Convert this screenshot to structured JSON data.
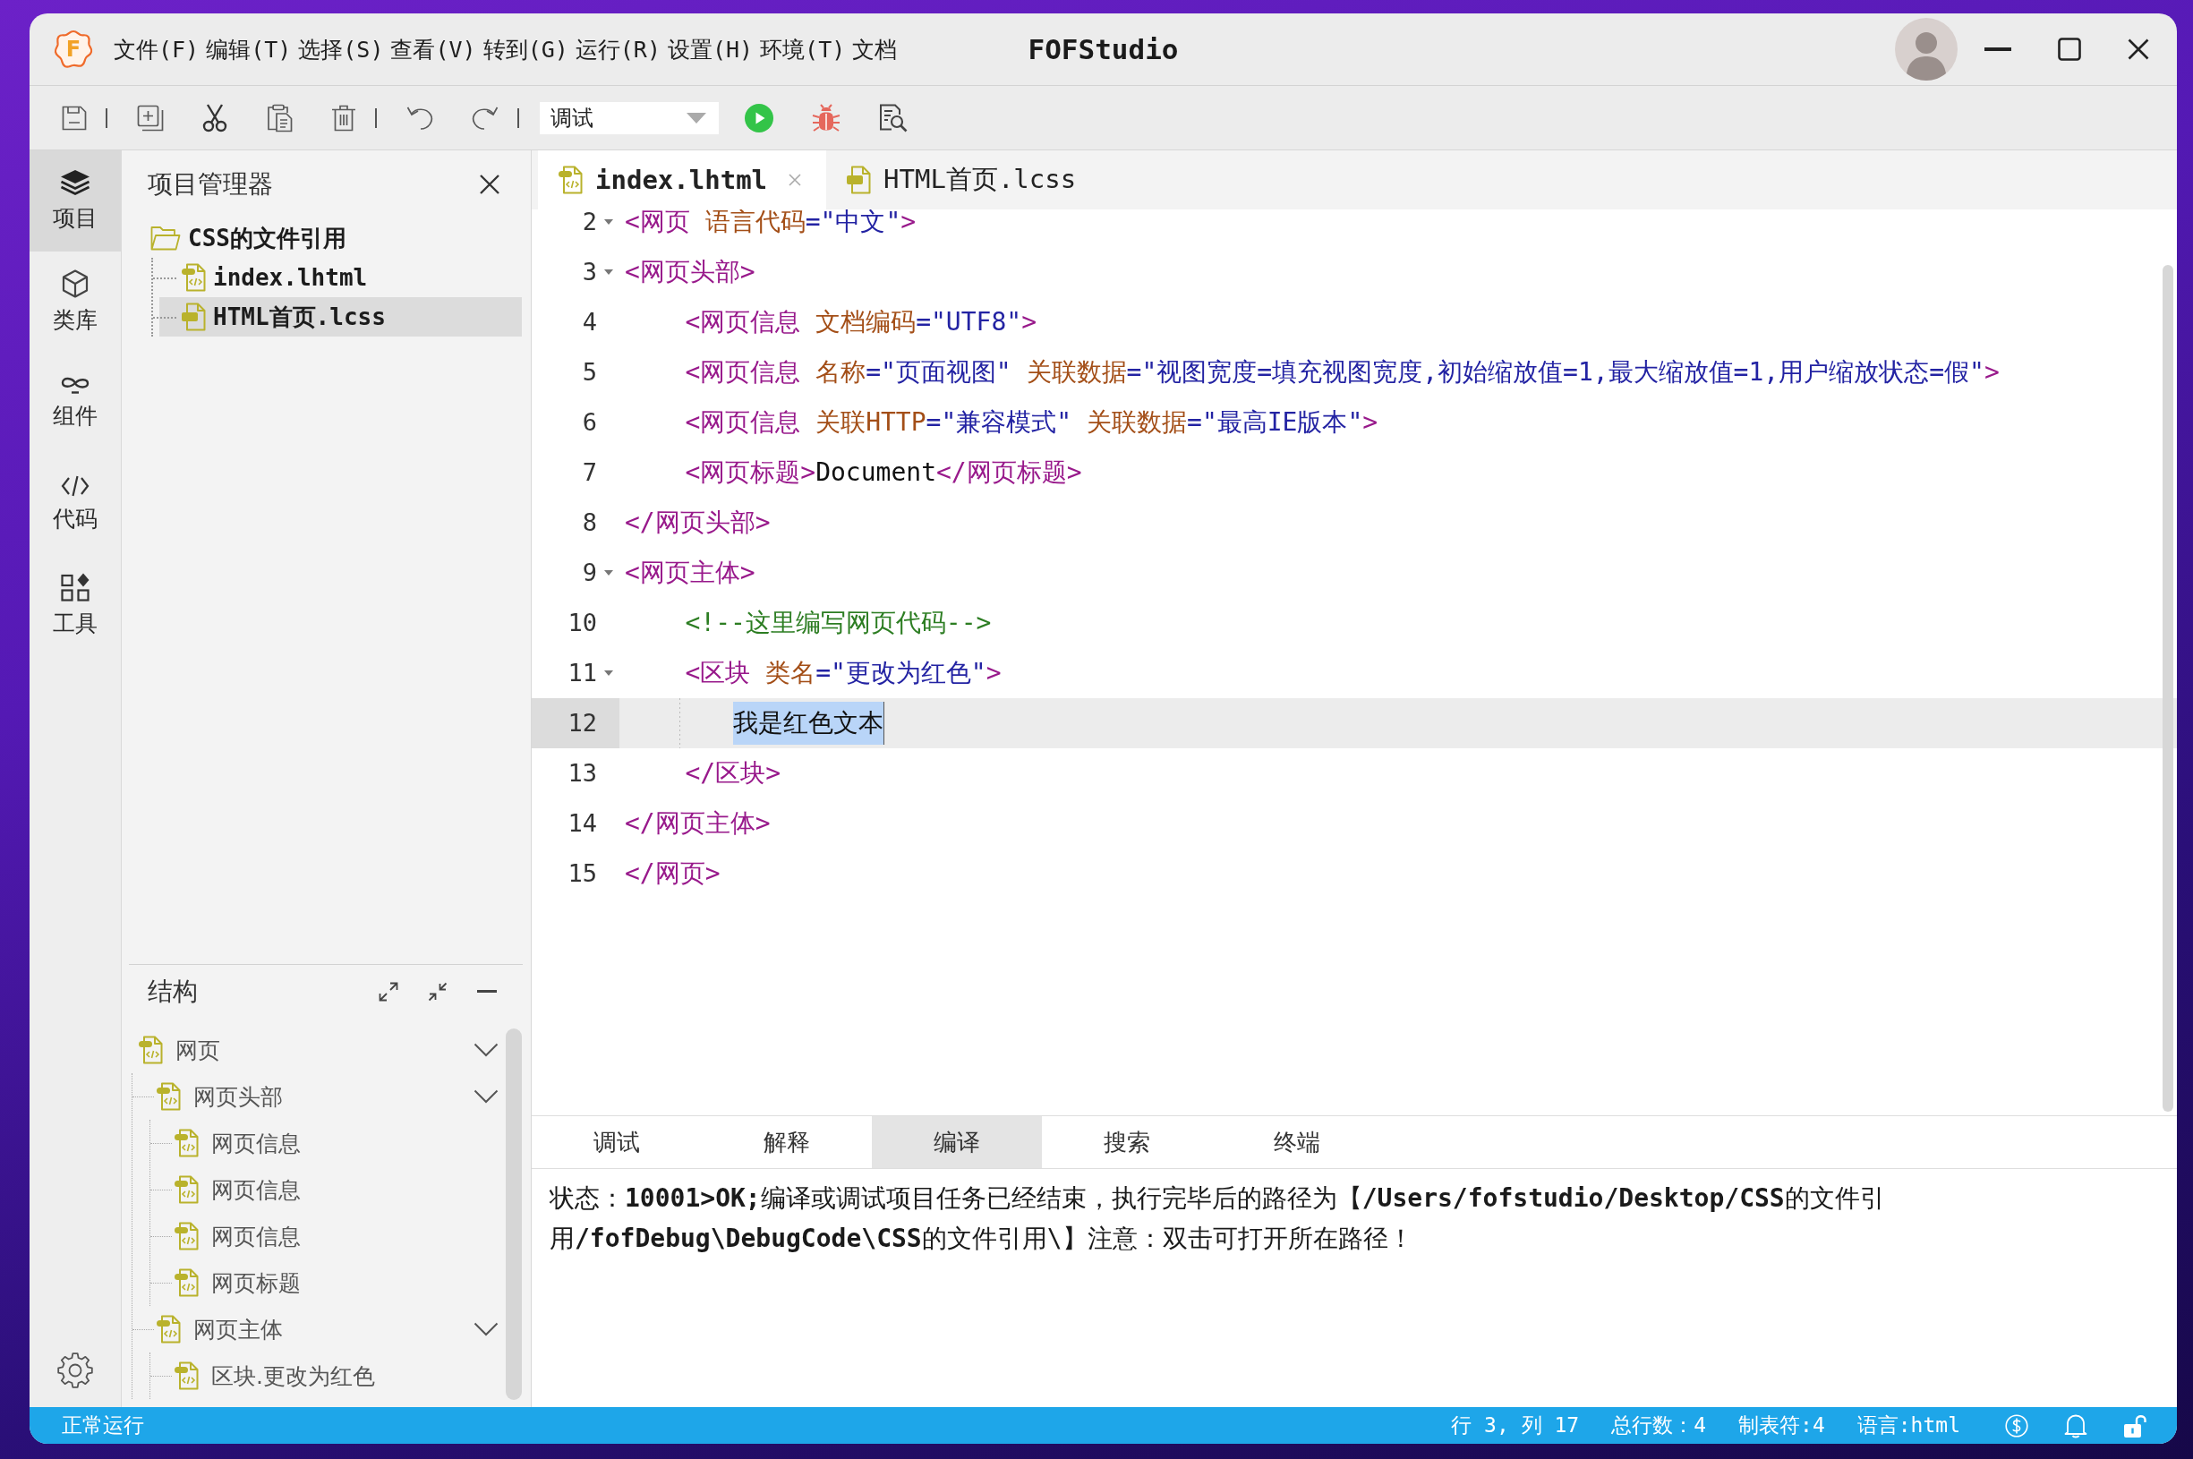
{
  "window": {
    "logo": "F",
    "menu": [
      "文件(F)",
      "编辑(T)",
      "选择(S)",
      "查看(V)",
      "转到(G)",
      "运行(R)",
      "设置(H)",
      "环境(T)",
      "文档"
    ],
    "title": "FOFStudio"
  },
  "toolbar": {
    "run_mode": "调试"
  },
  "activity_bar": {
    "items": [
      {
        "label": "项目",
        "selected": true
      },
      {
        "label": "类库",
        "selected": false
      },
      {
        "label": "组件",
        "selected": false
      },
      {
        "label": "代码",
        "selected": false
      },
      {
        "label": "工具",
        "selected": false
      }
    ]
  },
  "project_panel": {
    "title": "项目管理器",
    "tree": [
      {
        "label": "CSS的文件引用",
        "kind": "folder",
        "selected": false,
        "children": [
          {
            "label": "index.lhtml",
            "kind": "lhtml",
            "selected": false
          },
          {
            "label": "HTML首页.lcss",
            "kind": "lcss",
            "selected": true
          }
        ]
      }
    ]
  },
  "structure_panel": {
    "title": "结构",
    "tree": [
      {
        "label": "网页",
        "expanded": true,
        "children": [
          {
            "label": "网页头部",
            "expanded": true,
            "children": [
              {
                "label": "网页信息"
              },
              {
                "label": "网页信息"
              },
              {
                "label": "网页信息"
              },
              {
                "label": "网页标题"
              }
            ]
          },
          {
            "label": "网页主体",
            "expanded": true,
            "children": [
              {
                "label": "区块.更改为红色"
              }
            ]
          }
        ]
      }
    ]
  },
  "editor": {
    "tabs": [
      {
        "label": "index.lhtml",
        "kind": "lhtml",
        "selected": true
      },
      {
        "label": "HTML首页.lcss",
        "kind": "lcss",
        "selected": false
      }
    ],
    "lines": [
      {
        "number": "2",
        "foldable": true,
        "current": false,
        "tokens": [
          {
            "kind": "tag",
            "text": "<网页"
          },
          {
            "kind": "attr",
            "text": " 语言代码"
          },
          {
            "kind": "value",
            "text": "=\"中文\""
          },
          {
            "kind": "tag",
            "text": ">"
          }
        ]
      },
      {
        "number": "3",
        "foldable": true,
        "current": false,
        "tokens": [
          {
            "kind": "tag",
            "text": "<网页头部>"
          }
        ]
      },
      {
        "number": "4",
        "foldable": false,
        "current": false,
        "tokens": [
          {
            "kind": "tag",
            "text": "    <网页信息"
          },
          {
            "kind": "attr",
            "text": " 文档编码"
          },
          {
            "kind": "value",
            "text": "=\"UTF8\""
          },
          {
            "kind": "tag",
            "text": ">"
          }
        ]
      },
      {
        "number": "5",
        "foldable": false,
        "current": false,
        "tokens": [
          {
            "kind": "tag",
            "text": "    <网页信息"
          },
          {
            "kind": "attr",
            "text": " 名称"
          },
          {
            "kind": "value",
            "text": "=\"页面视图\""
          },
          {
            "kind": "attr",
            "text": " 关联数据"
          },
          {
            "kind": "value",
            "text": "=\"视图宽度=填充视图宽度,初始缩放值=1,最大缩放值=1,用户缩放状态=假\""
          },
          {
            "kind": "tag",
            "text": ">"
          }
        ]
      },
      {
        "number": "6",
        "foldable": false,
        "current": false,
        "tokens": [
          {
            "kind": "tag",
            "text": "    <网页信息"
          },
          {
            "kind": "attr",
            "text": " 关联HTTP"
          },
          {
            "kind": "value",
            "text": "=\"兼容模式\""
          },
          {
            "kind": "attr",
            "text": " 关联数据"
          },
          {
            "kind": "value",
            "text": "=\"最高IE版本\""
          },
          {
            "kind": "tag",
            "text": ">"
          }
        ]
      },
      {
        "number": "7",
        "foldable": false,
        "current": false,
        "tokens": [
          {
            "kind": "tag",
            "text": "    <网页标题>"
          },
          {
            "kind": "text",
            "text": "Document"
          },
          {
            "kind": "tag",
            "text": "</网页标题>"
          }
        ]
      },
      {
        "number": "8",
        "foldable": false,
        "current": false,
        "tokens": [
          {
            "kind": "tag",
            "text": "</网页头部>"
          }
        ]
      },
      {
        "number": "9",
        "foldable": true,
        "current": false,
        "tokens": [
          {
            "kind": "tag",
            "text": "<网页主体>"
          }
        ]
      },
      {
        "number": "10",
        "foldable": false,
        "current": false,
        "tokens": [
          {
            "kind": "comment",
            "text": "    <!--这里编写网页代码-->"
          }
        ]
      },
      {
        "number": "11",
        "foldable": true,
        "current": false,
        "tokens": [
          {
            "kind": "tag",
            "text": "    <区块"
          },
          {
            "kind": "attr",
            "text": " 类名"
          },
          {
            "kind": "value",
            "text": "=\"更改为红色\""
          },
          {
            "kind": "tag",
            "text": ">"
          }
        ]
      },
      {
        "number": "12",
        "foldable": false,
        "current": true,
        "tokens": [
          {
            "kind": "indent"
          },
          {
            "kind": "selection",
            "text": "我是红色文本"
          }
        ]
      },
      {
        "number": "13",
        "foldable": false,
        "current": false,
        "tokens": [
          {
            "kind": "tag",
            "text": "    </区块>"
          }
        ]
      },
      {
        "number": "14",
        "foldable": false,
        "current": false,
        "tokens": [
          {
            "kind": "tag",
            "text": "</网页主体>"
          }
        ]
      },
      {
        "number": "15",
        "foldable": false,
        "current": false,
        "tokens": [
          {
            "kind": "tag",
            "text": "</网页>"
          }
        ]
      }
    ]
  },
  "bottom_panel": {
    "tabs": [
      {
        "label": "调试",
        "selected": false
      },
      {
        "label": "解释",
        "selected": false
      },
      {
        "label": "编译",
        "selected": true
      },
      {
        "label": "搜索",
        "selected": false
      },
      {
        "label": "终端",
        "selected": false
      }
    ],
    "output": "状态：**10001>OK;**编译或调试项目任务已经结束，执行完毕后的路径为【**/Users/fofstudio/Desktop/CSS**的文件引用**/fofDebug\\DebugCode\\CSS**的文件引用\\】注意：双击可打开所在路径！"
  },
  "status_bar": {
    "state": "正常运行",
    "items": [
      "行 3, 列 17",
      "总行数：4",
      "制表符:4",
      "语言:html"
    ]
  }
}
